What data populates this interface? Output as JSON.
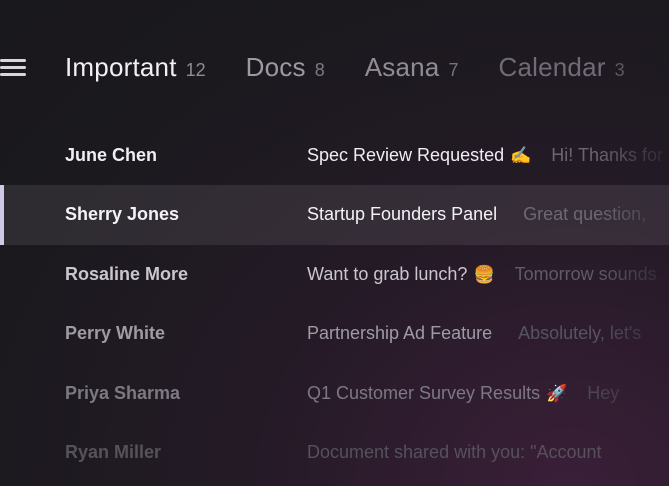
{
  "header": {
    "tabs": [
      {
        "label": "Important",
        "count": "12"
      },
      {
        "label": "Docs",
        "count": "8"
      },
      {
        "label": "Asana",
        "count": "7"
      },
      {
        "label": "Calendar",
        "count": "3"
      }
    ]
  },
  "icons": {
    "menu": "hamburger-menu-icon",
    "writing_hand": "✍️",
    "burger": "🍔",
    "rocket": "🚀"
  },
  "colors": {
    "selection_indicator": "#cfc8e6",
    "background_accent": "#3a1f38"
  },
  "messages": [
    {
      "sender": "June Chen",
      "subject": "Spec Review Requested",
      "emoji": "✍️",
      "preview": "Hi! Thanks for"
    },
    {
      "sender": "Sherry Jones",
      "subject": "Startup Founders Panel",
      "emoji": "",
      "preview": "Great question,"
    },
    {
      "sender": "Rosaline More",
      "subject": "Want to grab lunch?",
      "emoji": "🍔",
      "preview": "Tomorrow sounds"
    },
    {
      "sender": "Perry White",
      "subject": "Partnership Ad Feature",
      "emoji": "",
      "preview": "Absolutely, let's"
    },
    {
      "sender": "Priya Sharma",
      "subject": "Q1 Customer Survey Results",
      "emoji": "🚀",
      "preview": "Hey"
    },
    {
      "sender": "Ryan Miller",
      "subject": "Document shared with you: \"Account",
      "emoji": "",
      "preview": ""
    }
  ]
}
